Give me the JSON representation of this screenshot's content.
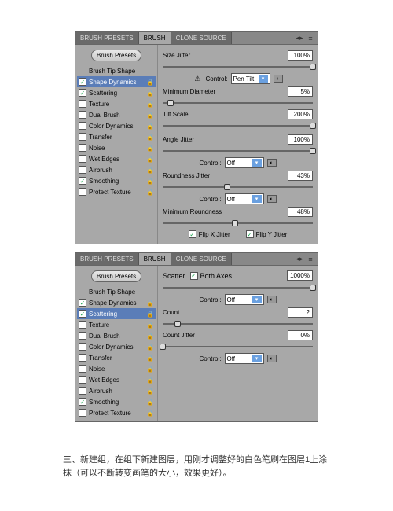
{
  "tabs": {
    "presets": "BRUSH PRESETS",
    "brush": "BRUSH",
    "clone": "CLONE SOURCE"
  },
  "presets_btn": "Brush Presets",
  "sidebar": {
    "items": [
      {
        "label": "Brush Tip Shape",
        "checked": null,
        "lock": false
      },
      {
        "label": "Shape Dynamics",
        "checked": true,
        "lock": true
      },
      {
        "label": "Scattering",
        "checked": true,
        "lock": true
      },
      {
        "label": "Texture",
        "checked": false,
        "lock": true
      },
      {
        "label": "Dual Brush",
        "checked": false,
        "lock": true
      },
      {
        "label": "Color Dynamics",
        "checked": false,
        "lock": true
      },
      {
        "label": "Transfer",
        "checked": false,
        "lock": true
      },
      {
        "label": "Noise",
        "checked": false,
        "lock": true
      },
      {
        "label": "Wet Edges",
        "checked": false,
        "lock": true
      },
      {
        "label": "Airbrush",
        "checked": false,
        "lock": true
      },
      {
        "label": "Smoothing",
        "checked": true,
        "lock": true
      },
      {
        "label": "Protect Texture",
        "checked": false,
        "lock": true
      }
    ]
  },
  "panel1": {
    "size_jitter": {
      "label": "Size Jitter",
      "value": "100%"
    },
    "control1": {
      "label": "Control:",
      "value": "Pen Tilt",
      "warn": true
    },
    "min_diameter": {
      "label": "Minimum Diameter",
      "value": "5%"
    },
    "tilt_scale": {
      "label": "Tilt Scale",
      "value": "200%"
    },
    "angle_jitter": {
      "label": "Angle Jitter",
      "value": "100%"
    },
    "control2": {
      "label": "Control:",
      "value": "Off"
    },
    "roundness_jitter": {
      "label": "Roundness Jitter",
      "value": "43%"
    },
    "control3": {
      "label": "Control:",
      "value": "Off"
    },
    "min_roundness": {
      "label": "Minimum Roundness",
      "value": "48%"
    },
    "flip_x": "Flip X Jitter",
    "flip_y": "Flip Y Jitter"
  },
  "panel2": {
    "scatter": {
      "label": "Scatter",
      "both": "Both Axes",
      "value": "1000%"
    },
    "control1": {
      "label": "Control:",
      "value": "Off"
    },
    "count": {
      "label": "Count",
      "value": "2"
    },
    "count_jitter": {
      "label": "Count Jitter",
      "value": "0%"
    },
    "control2": {
      "label": "Control:",
      "value": "Off"
    }
  },
  "caption": "三、新建组，在组下新建图层，用刚才调整好的白色笔刷在图层1上涂抹（可以不断转变画笔的大小，效果更好）。"
}
